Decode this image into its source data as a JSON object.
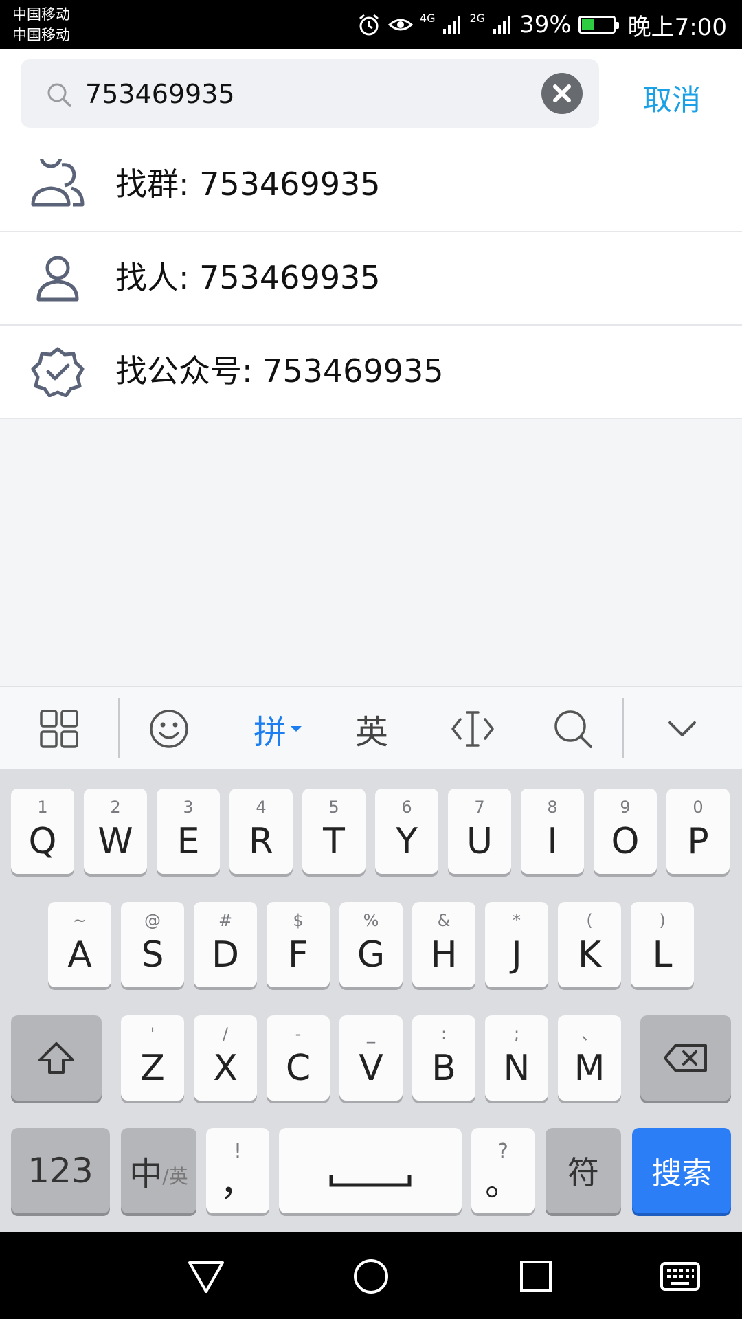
{
  "status_bar": {
    "carrier_1": "中国移动",
    "carrier_2": "中国移动",
    "network_4g": "4G",
    "network_2g": "2G",
    "battery_percent": "39%",
    "battery_level": 0.39,
    "time": "晚上7:00"
  },
  "search": {
    "query": "753469935",
    "cancel_label": "取消"
  },
  "results": [
    {
      "label": "找群: 753469935",
      "icon": "group-icon"
    },
    {
      "label": "找人: 753469935",
      "icon": "person-icon"
    },
    {
      "label": "找公众号: 753469935",
      "icon": "verified-badge-icon"
    }
  ],
  "keyboard_toolbar": {
    "pinyin_label": "拼",
    "english_label": "英"
  },
  "keyboard": {
    "row1": [
      {
        "hint": "1",
        "key": "Q"
      },
      {
        "hint": "2",
        "key": "W"
      },
      {
        "hint": "3",
        "key": "E"
      },
      {
        "hint": "4",
        "key": "R"
      },
      {
        "hint": "5",
        "key": "T"
      },
      {
        "hint": "6",
        "key": "Y"
      },
      {
        "hint": "7",
        "key": "U"
      },
      {
        "hint": "8",
        "key": "I"
      },
      {
        "hint": "9",
        "key": "O"
      },
      {
        "hint": "0",
        "key": "P"
      }
    ],
    "row2": [
      {
        "hint": "~",
        "key": "A"
      },
      {
        "hint": "@",
        "key": "S"
      },
      {
        "hint": "#",
        "key": "D"
      },
      {
        "hint": "$",
        "key": "F"
      },
      {
        "hint": "%",
        "key": "G"
      },
      {
        "hint": "&",
        "key": "H"
      },
      {
        "hint": "*",
        "key": "J"
      },
      {
        "hint": "(",
        "key": "K"
      },
      {
        "hint": ")",
        "key": "L"
      }
    ],
    "row3": [
      {
        "hint": "'",
        "key": "Z"
      },
      {
        "hint": "/",
        "key": "X"
      },
      {
        "hint": "-",
        "key": "C"
      },
      {
        "hint": "_",
        "key": "V"
      },
      {
        "hint": ":",
        "key": "B"
      },
      {
        "hint": ";",
        "key": "N"
      },
      {
        "hint": "、",
        "key": "M"
      }
    ],
    "num_label": "123",
    "lang_main": "中",
    "lang_sub": "/英",
    "comma_hint": "!",
    "comma_key": "，",
    "period_hint": "?",
    "period_key": "。",
    "symbol_label": "符",
    "search_label": "搜索"
  }
}
